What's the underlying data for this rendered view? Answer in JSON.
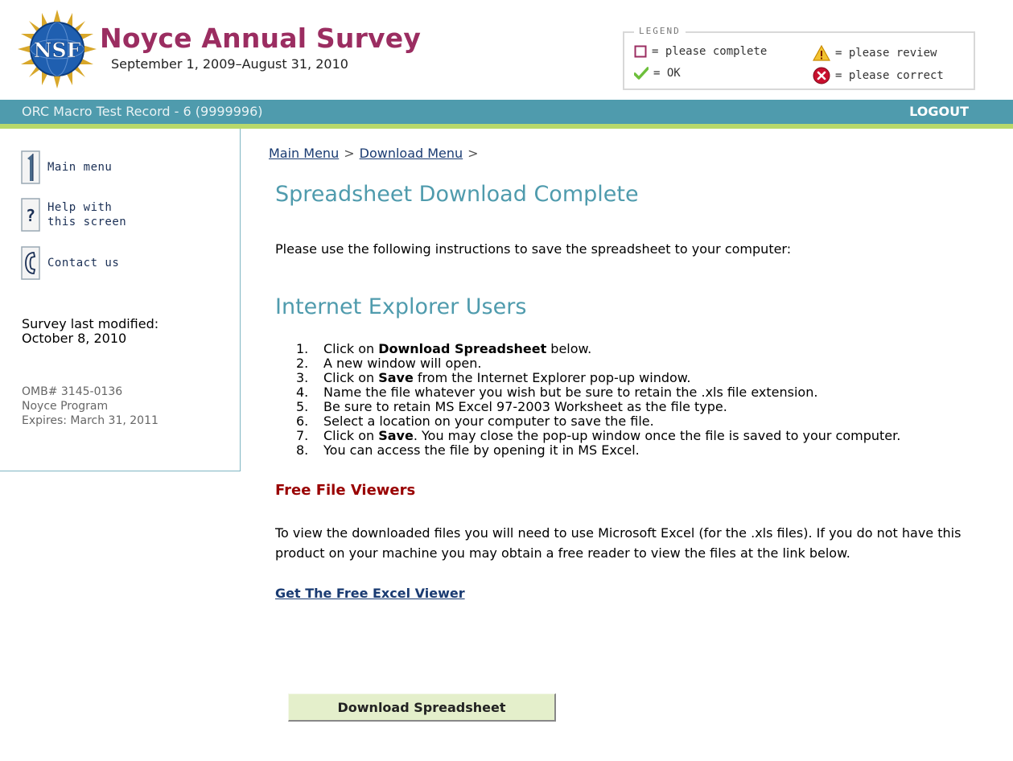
{
  "header": {
    "logo_text": "NSF",
    "title": "Noyce Annual Survey",
    "dates": "September 1, 2009–August 31, 2010"
  },
  "legend": {
    "title": "LEGEND",
    "complete": "= please complete",
    "ok": "= OK",
    "review": "= please review",
    "correct": "= please correct"
  },
  "topbar": {
    "record": "ORC Macro Test Record - 6 (9999996)",
    "logout": "LOGOUT"
  },
  "sidebar": {
    "main_menu": "Main menu",
    "help": "Help with\nthis screen",
    "contact": "Contact us",
    "modified_label": "Survey last modified:",
    "modified_date": "October 8, 2010",
    "omb": "OMB# 3145-0136",
    "program": "Noyce Program",
    "expires": "Expires: March 31, 2011"
  },
  "breadcrumb": {
    "main_menu": "Main Menu",
    "download_menu": "Download Menu",
    "separator": ">"
  },
  "main": {
    "title": "Spreadsheet Download Complete",
    "intro": "Please use the following instructions to save the spreadsheet to your computer:",
    "section_title": "Internet Explorer Users",
    "steps": [
      {
        "num": "1.",
        "pre": "Click on ",
        "bold": "Download Spreadsheet",
        "post": " below."
      },
      {
        "num": "2.",
        "pre": "A new window will open.",
        "bold": "",
        "post": ""
      },
      {
        "num": "3.",
        "pre": "Click on ",
        "bold": "Save",
        "post": " from the Internet Explorer pop-up window."
      },
      {
        "num": "4.",
        "pre": "Name the file whatever you wish but be sure to retain the .xls file extension.",
        "bold": "",
        "post": ""
      },
      {
        "num": "5.",
        "pre": "Be sure to retain MS Excel 97-2003 Worksheet as the file type.",
        "bold": "",
        "post": ""
      },
      {
        "num": "6.",
        "pre": "Select a location on your computer to save the file.",
        "bold": "",
        "post": ""
      },
      {
        "num": "7.",
        "pre": "Click on ",
        "bold": "Save",
        "post": ". You may close the pop-up window once the file is saved to your computer."
      },
      {
        "num": "8.",
        "pre": "You can access the file by opening it in MS Excel.",
        "bold": "",
        "post": ""
      }
    ],
    "viewers_title": "Free File Viewers",
    "viewers_text": "To view the downloaded files you will need to use Microsoft Excel (for the .xls files). If you do not have this product on your machine you may obtain a free reader to view the files at the link below.",
    "viewer_link": "Get The Free Excel Viewer",
    "download_button": "Download Spreadsheet"
  },
  "colors": {
    "title": "#9b2d61",
    "accent": "#4f9bad",
    "bar_underline": "#b8d86b",
    "viewers_title": "#990000",
    "link": "#1a3b72",
    "button_bg": "#e4efcb"
  }
}
